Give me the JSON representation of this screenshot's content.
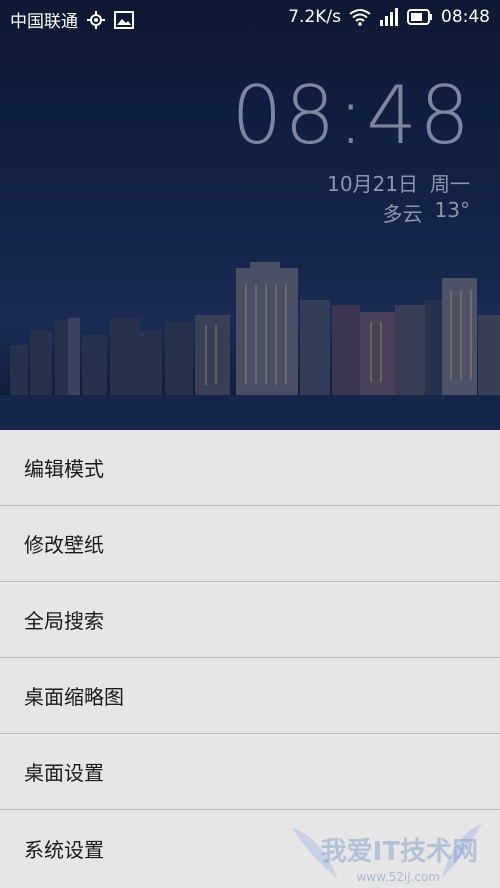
{
  "status_bar": {
    "carrier": "中国联通",
    "net_speed": "7.2K/s",
    "time": "08:48",
    "icons": [
      "location-icon",
      "image-notification-icon",
      "wifi-icon",
      "signal-icon",
      "battery-icon"
    ]
  },
  "clock_widget": {
    "time": "08:48",
    "date": "10月21日",
    "weekday": "周一",
    "weather": "多云",
    "temperature": "13°"
  },
  "menu": {
    "items": [
      {
        "label": "编辑模式"
      },
      {
        "label": "修改壁纸"
      },
      {
        "label": "全局搜索"
      },
      {
        "label": "桌面缩略图"
      },
      {
        "label": "桌面设置"
      },
      {
        "label": "系统设置"
      }
    ]
  },
  "watermark": {
    "text": "我爱IT技术网",
    "url": "www.52ij.com"
  },
  "colors": {
    "menu_bg": "#e6e6e6",
    "divider": "#b8b8b8",
    "wallpaper_top": "#0d1833"
  }
}
